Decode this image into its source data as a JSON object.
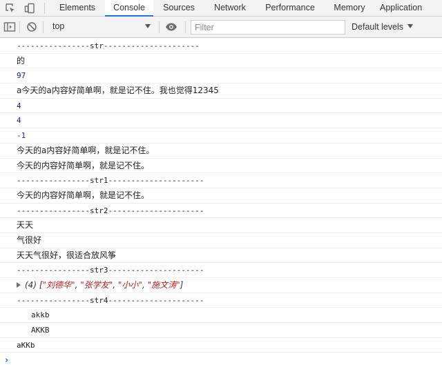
{
  "tabs": [
    "Elements",
    "Console",
    "Sources",
    "Network",
    "Performance",
    "Memory",
    "Application"
  ],
  "active_tab": "Console",
  "toolbar": {
    "context": "top",
    "filter_placeholder": "Filter",
    "levels": "Default levels"
  },
  "icons": {
    "inspect": "inspect-element-icon",
    "device": "device-toolbar-icon",
    "sidebar": "show-sidebar-icon",
    "clear": "clear-console-icon",
    "eye": "live-expression-eye-icon",
    "prompt": "console-prompt-chevron-icon"
  },
  "colors": {
    "number": "#1a1aa6",
    "string": "#c41a16",
    "accent": "#1a73e8"
  },
  "messages": [
    "----------------str---------------------",
    "的",
    "97",
    "a今天的a内容好简单啊，就是记不住。我也觉得12345",
    "4",
    "4",
    "-1",
    "今天的a内容好简单啊，就是记不住。",
    "今天的内容好简单啊，就是记不住。",
    "----------------str1---------------------",
    "今天的内容好简单啊，就是记不住。",
    "----------------str2---------------------",
    "天天",
    "气很好",
    "天天气很好，很适合放风筝",
    "----------------str3---------------------",
    "----------------str4---------------------",
    "akkb",
    "AKKB",
    "aKKb"
  ],
  "array_preview": {
    "count": "(4)",
    "open": "[",
    "items": [
      "\"刘德华\"",
      "\"张学友\"",
      "\"小小\"",
      "\"施文涛\""
    ],
    "sep": ", ",
    "close": "]"
  }
}
